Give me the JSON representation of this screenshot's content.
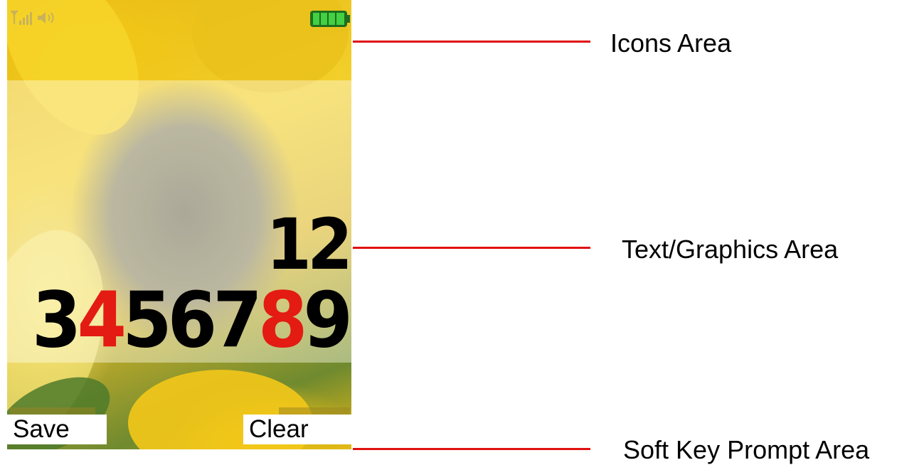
{
  "screen": {
    "line1": "12",
    "line2_parts": [
      "3",
      "4",
      "567",
      "8",
      "9"
    ],
    "softkeys": {
      "left": "Save",
      "right": "Clear"
    },
    "status_icons": [
      "signal-icon",
      "speaker-icon",
      "battery-icon"
    ],
    "accent_color": "#e31b12",
    "battery_color": "#33cc33"
  },
  "annotations": {
    "icons_area": "Icons Area",
    "text_graphics_area": "Text/Graphics Area",
    "soft_key_prompt_area": "Soft Key Prompt Area",
    "line_color": "#e01010"
  }
}
